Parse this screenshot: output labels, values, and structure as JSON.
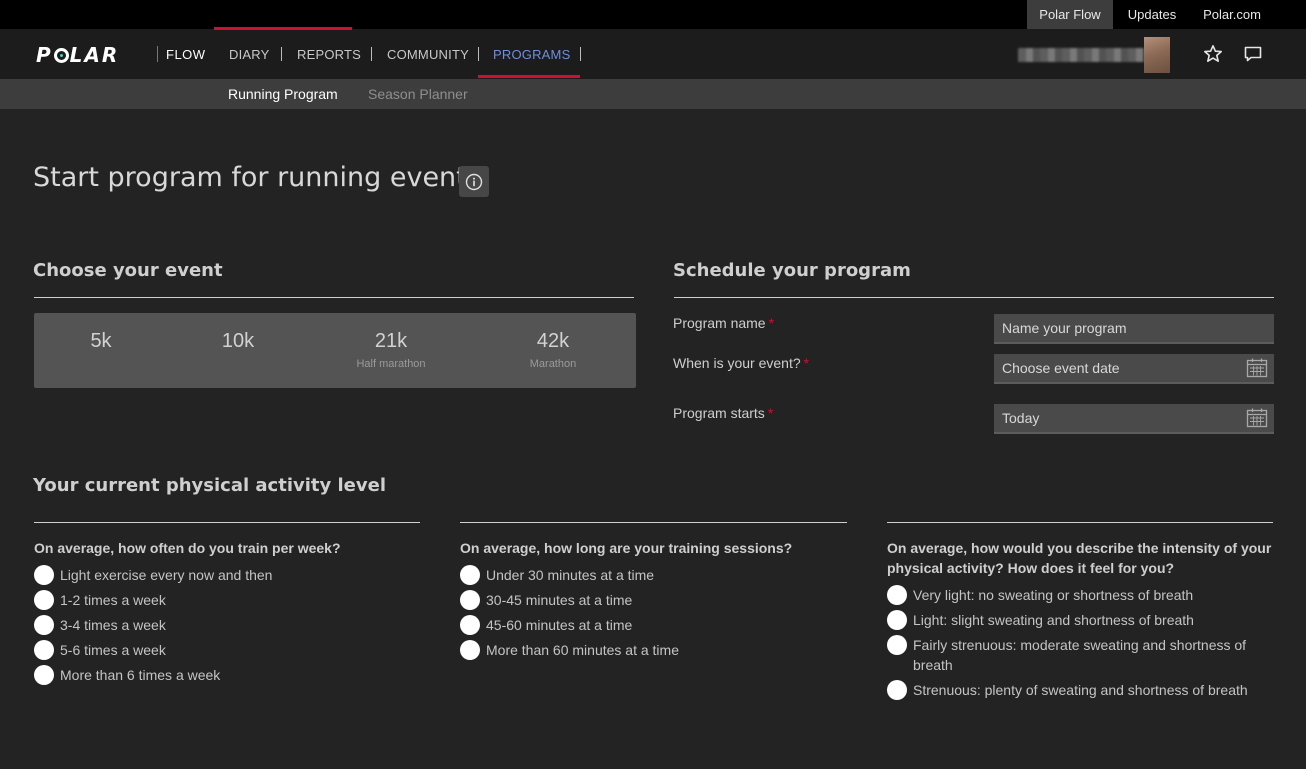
{
  "topbar": {
    "links": [
      "Polar Flow",
      "Updates",
      "Polar.com"
    ]
  },
  "nav": {
    "logo": "POLAR",
    "brand": "FLOW",
    "items": [
      "DIARY",
      "REPORTS",
      "COMMUNITY",
      "PROGRAMS"
    ],
    "active": "PROGRAMS"
  },
  "subnav": {
    "items": [
      "Running Program",
      "Season Planner"
    ],
    "active": "Running Program"
  },
  "page": {
    "title": "Start program for running event"
  },
  "event_section": {
    "title": "Choose your event",
    "events": [
      {
        "label": "5k",
        "sub": ""
      },
      {
        "label": "10k",
        "sub": ""
      },
      {
        "label": "21k",
        "sub": "Half marathon"
      },
      {
        "label": "42k",
        "sub": "Marathon"
      }
    ]
  },
  "schedule": {
    "title": "Schedule your program",
    "program_name_label": "Program name",
    "program_name_placeholder": "Name your program",
    "event_date_label": "When is your event?",
    "event_date_placeholder": "Choose event date",
    "start_label": "Program starts",
    "start_value": "Today",
    "required_mark": "*"
  },
  "activity": {
    "title": "Your current physical activity level",
    "questions": [
      {
        "q": "On average, how often do you train per week?",
        "options": [
          "Light exercise every now and then",
          "1-2 times a week",
          "3-4 times a week",
          "5-6 times a week",
          "More than 6 times a week"
        ]
      },
      {
        "q": "On average, how long are your training sessions?",
        "options": [
          "Under 30 minutes at a time",
          "30-45 minutes at a time",
          "45-60 minutes at a time",
          "More than 60 minutes at a time"
        ]
      },
      {
        "q": "On average, how would you describe the intensity of your physical activity? How does it feel for you?",
        "options": [
          "Very light: no sweating or shortness of breath",
          "Light: slight sweating and shortness of breath",
          "Fairly strenuous: moderate sweating and shortness of breath",
          "Strenuous: plenty of sweating and shortness of breath"
        ]
      }
    ]
  },
  "colors": {
    "accent": "#d01030",
    "active_nav": "#6f8fd8",
    "background": "#232323"
  },
  "icons": [
    "info-icon",
    "star-icon",
    "messages-icon",
    "calendar-icon"
  ]
}
